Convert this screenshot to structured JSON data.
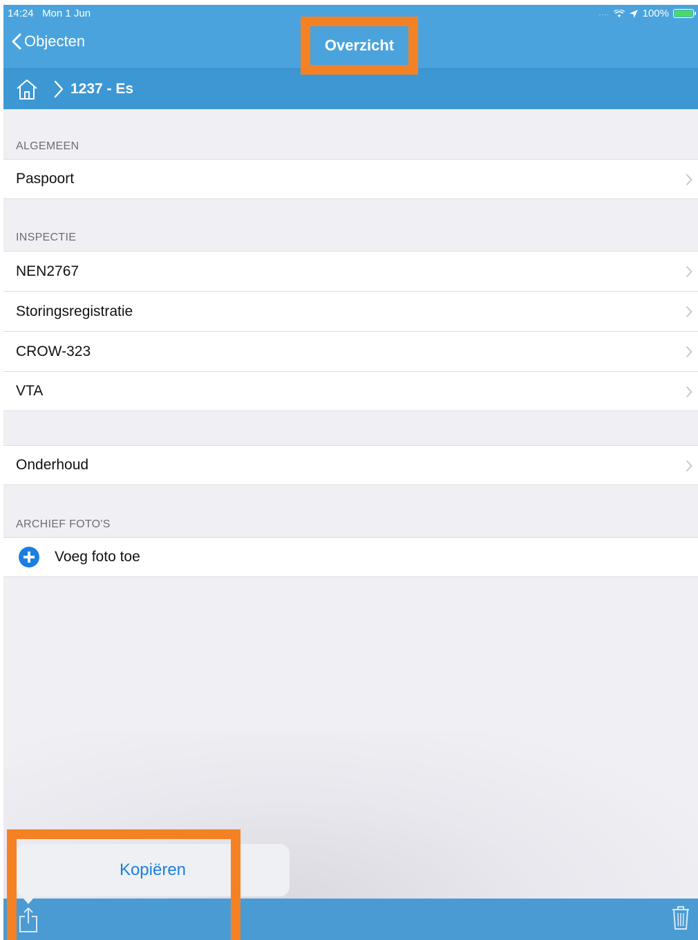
{
  "status_bar": {
    "time": "14:24",
    "date": "Mon 1 Jun",
    "signal": "....",
    "battery_percent": "100%"
  },
  "nav": {
    "back_label": "Objecten",
    "title": "Overzicht"
  },
  "breadcrumb": {
    "current": "1237 - Es"
  },
  "sections": {
    "algemeen": {
      "header": "ALGEMEEN",
      "items": [
        "Paspoort"
      ]
    },
    "inspectie": {
      "header": "INSPECTIE",
      "items": [
        "NEN2767",
        "Storingsregistratie",
        "CROW-323",
        "VTA"
      ]
    },
    "onderhoud": {
      "items": [
        "Onderhoud"
      ]
    },
    "archief": {
      "header": "ARCHIEF FOTO'S",
      "add_label": "Voeg foto toe"
    }
  },
  "popover": {
    "copy_label": "Kopiëren"
  },
  "colors": {
    "nav_blue": "#4aa3dc",
    "breadcrumb_blue": "#3d97d3",
    "accent_blue": "#1a7fe0",
    "highlight_orange": "#f58125",
    "battery_green": "#4cd964"
  }
}
